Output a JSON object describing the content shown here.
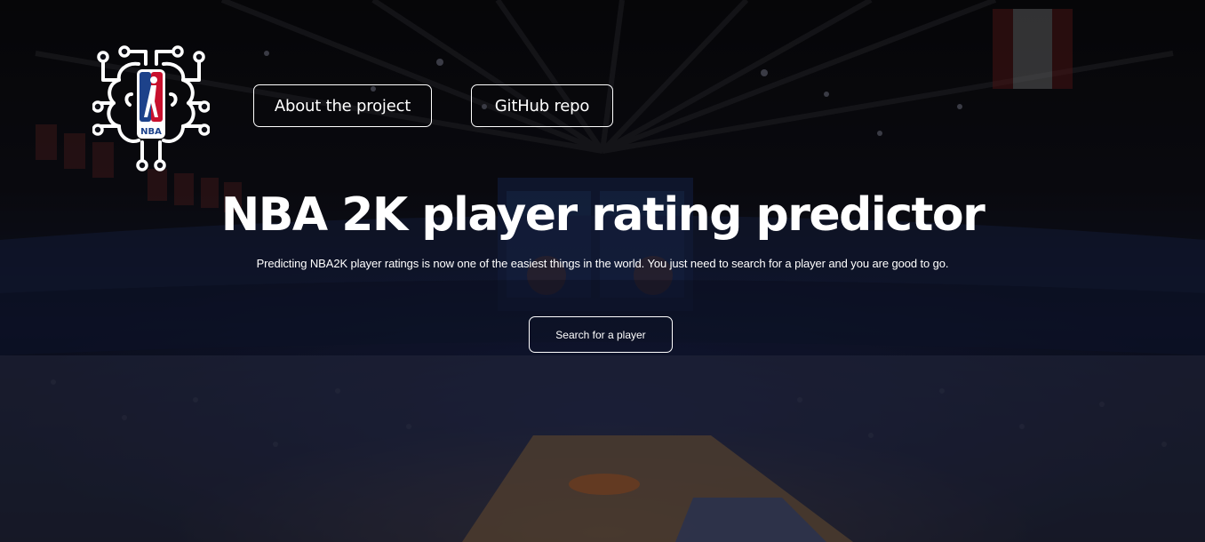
{
  "nav": {
    "about_label": "About the project",
    "github_label": "GitHub repo"
  },
  "hero": {
    "title": "NBA 2K player rating predictor",
    "subtitle": "Predicting NBA2K player ratings is now one of the easiest things in the world. You just need to search for a player and you are good to go.",
    "cta_label": "Search for a player"
  },
  "logo": {
    "icon": "nba-circuit-brain-logo",
    "badge_text": "NBA"
  },
  "background": {
    "icon": "arena-photo-background"
  },
  "colors": {
    "text": "#ffffff",
    "button_border": "#ffffff",
    "nba_red": "#c8102e",
    "nba_blue": "#1d428a"
  }
}
